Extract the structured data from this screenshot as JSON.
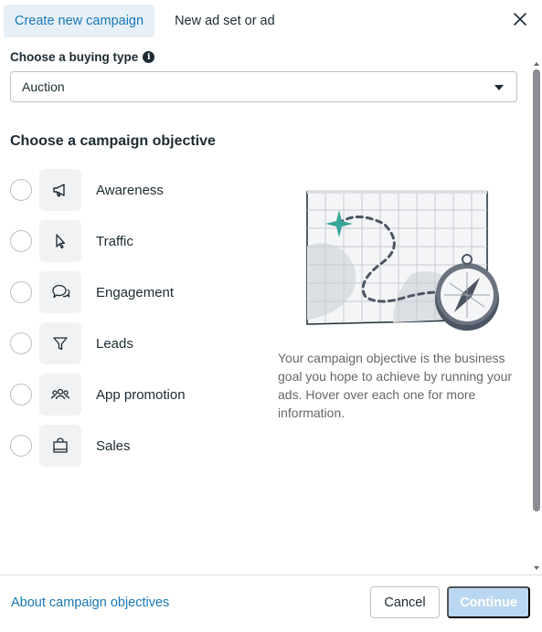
{
  "tabs": [
    {
      "label": "Create new campaign",
      "active": true
    },
    {
      "label": "New ad set or ad",
      "active": false
    }
  ],
  "buying_type": {
    "label": "Choose a buying type",
    "info_icon": "info-icon",
    "selected": "Auction"
  },
  "objective": {
    "title": "Choose a campaign objective",
    "options": [
      {
        "label": "Awareness",
        "icon": "megaphone-icon"
      },
      {
        "label": "Traffic",
        "icon": "cursor-icon"
      },
      {
        "label": "Engagement",
        "icon": "chat-bubbles-icon"
      },
      {
        "label": "Leads",
        "icon": "funnel-icon"
      },
      {
        "label": "App promotion",
        "icon": "people-group-icon"
      },
      {
        "label": "Sales",
        "icon": "shopping-bag-icon"
      }
    ],
    "description": "Your campaign objective is the business goal you hope to achieve by running your ads. Hover over each one for more information."
  },
  "footer": {
    "about_link": "About campaign objectives",
    "cancel_label": "Cancel",
    "continue_label": "Continue"
  },
  "colors": {
    "accent": "#1877b5",
    "active_tab_bg": "#e7f0f7",
    "continue_disabled": "#b9d7f0",
    "map_pin": "#3aa59a"
  }
}
